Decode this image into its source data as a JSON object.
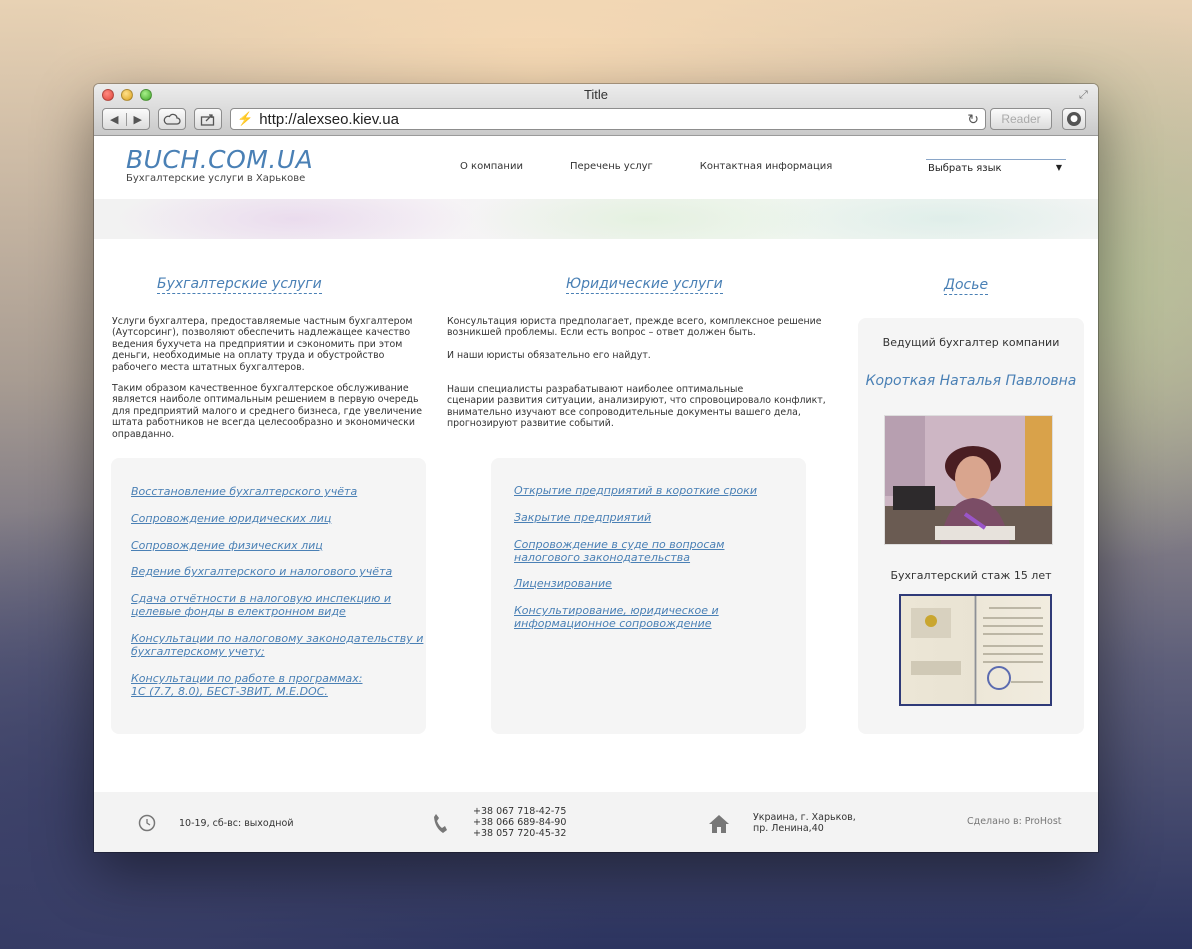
{
  "window": {
    "title": "Title",
    "url": "http://alexseo.kiev.ua",
    "reader_label": "Reader"
  },
  "site": {
    "logo": "BUCH.COM.UA",
    "tagline": "Бухгалтерские услуги в Харькове",
    "nav": [
      "О компании",
      "Перечень услуг",
      "Контактная информация"
    ],
    "language_select": "Выбрать язык"
  },
  "accounting": {
    "title": "Бухгалтерские услуги",
    "text1": " Услуги бухгалтера, предоставляемые частным бухгалтером\n(Аутсорсинг), позволяют обеспечить надлежащее качество\nведения бухучета на предприятии и сэкономить при этом\nденьги, необходимые на оплату труда и обустройство\nрабочего места штатных бухгалтеров.",
    "text2": " Таким образом качественное бухгалтерское обслуживание\nявляется наиболе оптимальным решением в первую очередь\nдля предприятий малого и среднего бизнеса, где увеличение\nштата работников не всегда целесообразно и экономически\nоправданно.",
    "links": [
      "Восстановление бухгалтерского учёта",
      "Сопровождение юридических лиц",
      "Сопровождение физических лиц",
      "Ведение бухгалтерского и налогового учёта",
      "Сдача отчётности в налоговую инспекцию и\nцелевые фонды в електронном виде",
      "Консультации по налоговому законодательству и\nбухгалтерскому учету;",
      "Консультации по работе в программах:\n1С (7.7, 8.0), БЕСТ-ЗВИТ, M.E.DOC."
    ]
  },
  "legal": {
    "title": "Юридические услуги",
    "text1": "  Консультация юриста предполагает, прежде всего, комплексное решение\nвозникшей проблемы. Если есть вопрос – ответ должен быть.",
    "text2": "И наши юристы обязательно его найдут.",
    "text3": "  Наши специалисты разрабатывают наиболее оптимальные\nсценарии развития ситуации, анализируют, что спровоцировало конфликт,\nвнимательно изучают все сопроводительные документы вашего дела,\nпрогнозируют развитие событий.",
    "links": [
      "Открытие предприятий в короткие сроки",
      "Закрытие предприятий",
      "Сопровождение в суде по вопросам \nналогового законодательства",
      "Лицензирование",
      "Консультирование, юридическое и\nинформационное сопровождение"
    ]
  },
  "dossier": {
    "title": "Досье",
    "lead": "Ведущий бухгалтер компании",
    "name": "Короткая Наталья Павловна",
    "experience": "Бухгалтерский стаж 15 лет"
  },
  "footer": {
    "hours": "10-19, сб-вс: выходной",
    "phones": "+38 067 718-42-75\n+38 066 689-84-90\n+38 057 720-45-32",
    "address": "Украина, г. Харьков,\nпр. Ленина,40",
    "credit": "Сделано в: ProHost"
  }
}
